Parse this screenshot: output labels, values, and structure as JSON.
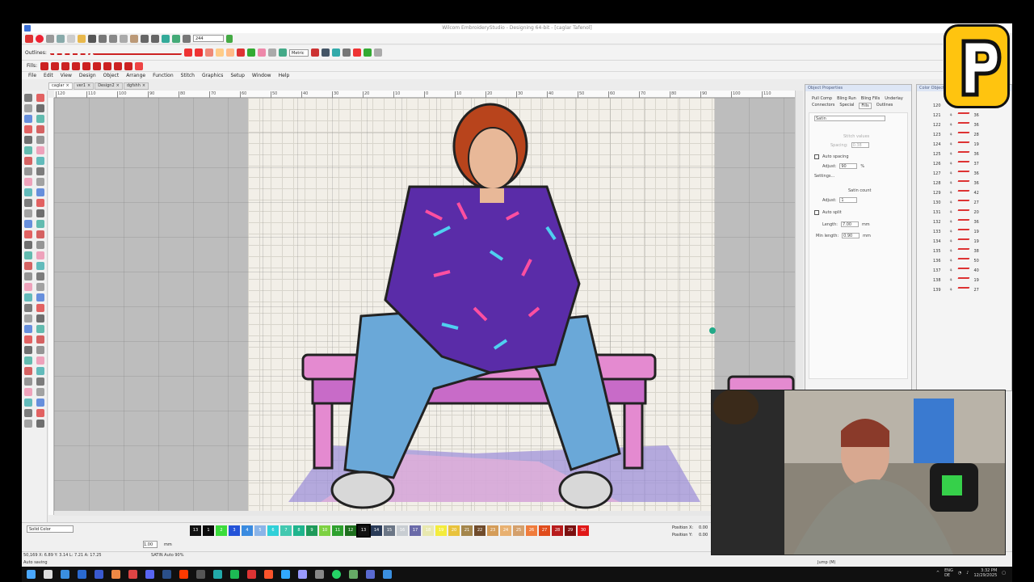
{
  "window": {
    "title": "Wilcom EmbroideryStudio - Designing 64-bit - [caglar    Tafenol]"
  },
  "toolbar": {
    "zoom_value": "244",
    "outlines_label": "Outlines:",
    "fills_label": "Fills:",
    "units": "Metric"
  },
  "menu": [
    "File",
    "Edit",
    "View",
    "Design",
    "Object",
    "Arrange",
    "Function",
    "Stitch",
    "Graphics",
    "Setup",
    "Window",
    "Help"
  ],
  "doc_tabs": [
    {
      "label": "caglar",
      "active": true
    },
    {
      "label": "ver1",
      "active": false
    },
    {
      "label": "Design2",
      "active": false
    },
    {
      "label": "dgfshh",
      "active": false
    }
  ],
  "ruler": {
    "ticks": [
      "120",
      "110",
      "100",
      "90",
      "80",
      "70",
      "60",
      "50",
      "40",
      "30",
      "20",
      "10",
      "0",
      "10",
      "20",
      "30",
      "40",
      "50",
      "60",
      "70",
      "80",
      "90",
      "100",
      "110"
    ]
  },
  "object_properties": {
    "title": "Object Properties",
    "tabs": [
      "Pull Comp",
      "Bling Run",
      "Bling Fills",
      "Underlay",
      "Connectors",
      "Special",
      "Fills",
      "Outlines"
    ],
    "active_tab": "Fills",
    "fill_type": "Satin",
    "stitch_values": "Stitch values",
    "spacing_label": "Spacing:",
    "spacing_value": "0.38",
    "auto_spacing_label": "Auto spacing",
    "adjust_label": "Adjust:",
    "adjust_value": "90",
    "percent": "%",
    "settings_label": "Settings...",
    "satin_count": "Satin count",
    "adjust2_value": "1",
    "auto_split_label": "Auto split",
    "length_label": "Length:",
    "length_value": "7.00",
    "min_length_label": "Min length:",
    "min_length_value": "0.90",
    "unit_mm": "mm"
  },
  "color_object": {
    "title": "Color Object",
    "rows": [
      {
        "id": "120",
        "count": "19"
      },
      {
        "id": "121",
        "count": "36"
      },
      {
        "id": "122",
        "count": "36"
      },
      {
        "id": "123",
        "count": "28"
      },
      {
        "id": "124",
        "count": "19"
      },
      {
        "id": "125",
        "count": "36"
      },
      {
        "id": "126",
        "count": "37"
      },
      {
        "id": "127",
        "count": "36"
      },
      {
        "id": "128",
        "count": "36"
      },
      {
        "id": "129",
        "count": "42"
      },
      {
        "id": "130",
        "count": "27"
      },
      {
        "id": "131",
        "count": "20"
      },
      {
        "id": "132",
        "count": "36"
      },
      {
        "id": "133",
        "count": "19"
      },
      {
        "id": "134",
        "count": "19"
      },
      {
        "id": "135",
        "count": "38"
      },
      {
        "id": "136",
        "count": "50"
      },
      {
        "id": "137",
        "count": "40"
      },
      {
        "id": "138",
        "count": "19"
      },
      {
        "id": "139",
        "count": "27"
      }
    ]
  },
  "bottom_toolbar": {
    "color_mode": "Solid Color",
    "zoom_field": "1.00",
    "unit": "mm",
    "position_x": "Position X:",
    "position_y": "Position Y:",
    "pos_x_value": "0.00",
    "pos_y_value": "0.00"
  },
  "palette": {
    "swatches": [
      {
        "n": "13",
        "c": "#111111"
      },
      {
        "n": "1",
        "c": "#0b0b0b"
      },
      {
        "n": "2",
        "c": "#3cdc3c"
      },
      {
        "n": "3",
        "c": "#2453d8"
      },
      {
        "n": "4",
        "c": "#3a8be0"
      },
      {
        "n": "5",
        "c": "#8ab4e8"
      },
      {
        "n": "6",
        "c": "#30d0d8"
      },
      {
        "n": "7",
        "c": "#42c8b0"
      },
      {
        "n": "8",
        "c": "#1fb48d"
      },
      {
        "n": "9",
        "c": "#1f9a5a"
      },
      {
        "n": "10",
        "c": "#7dd142"
      },
      {
        "n": "11",
        "c": "#2ea02e"
      },
      {
        "n": "12",
        "c": "#1e6f1e"
      },
      {
        "n": "13",
        "c": "#111111"
      },
      {
        "n": "14",
        "c": "#2a3b58"
      },
      {
        "n": "15",
        "c": "#6b7686"
      },
      {
        "n": "16",
        "c": "#c8cdd2"
      },
      {
        "n": "17",
        "c": "#6a6aa8"
      },
      {
        "n": "18",
        "c": "#e8e8b0"
      },
      {
        "n": "19",
        "c": "#f4ec3c"
      },
      {
        "n": "20",
        "c": "#e8c23c"
      },
      {
        "n": "21",
        "c": "#a4864c"
      },
      {
        "n": "22",
        "c": "#704c2c"
      },
      {
        "n": "23",
        "c": "#d49c58"
      },
      {
        "n": "24",
        "c": "#e8b070"
      },
      {
        "n": "25",
        "c": "#d4a06c"
      },
      {
        "n": "26",
        "c": "#f07c3c"
      },
      {
        "n": "27",
        "c": "#e04c1c"
      },
      {
        "n": "28",
        "c": "#b81c1c"
      },
      {
        "n": "29",
        "c": "#7c1010"
      },
      {
        "n": "30",
        "c": "#e01818"
      }
    ]
  },
  "status": {
    "coords": "50,169    X: 6.89 Y: 3.14 L: 7.21 A: 17.25",
    "stitch_type": "SATIN Auto 90%",
    "message": "Auto saving",
    "jump": "Jump (M)"
  },
  "taskbar": {
    "lang": "ENG",
    "layout": "DE",
    "time": "3:32 PM",
    "date": "12/29/2025"
  },
  "colors": {
    "accent": "#3a6fd6",
    "jacket": "#5a2ca8",
    "bench": "#e48ad0",
    "jeans": "#6aa8d8",
    "hoop_bg": "#f2efe8",
    "logo_yellow": "#ffc40f"
  }
}
